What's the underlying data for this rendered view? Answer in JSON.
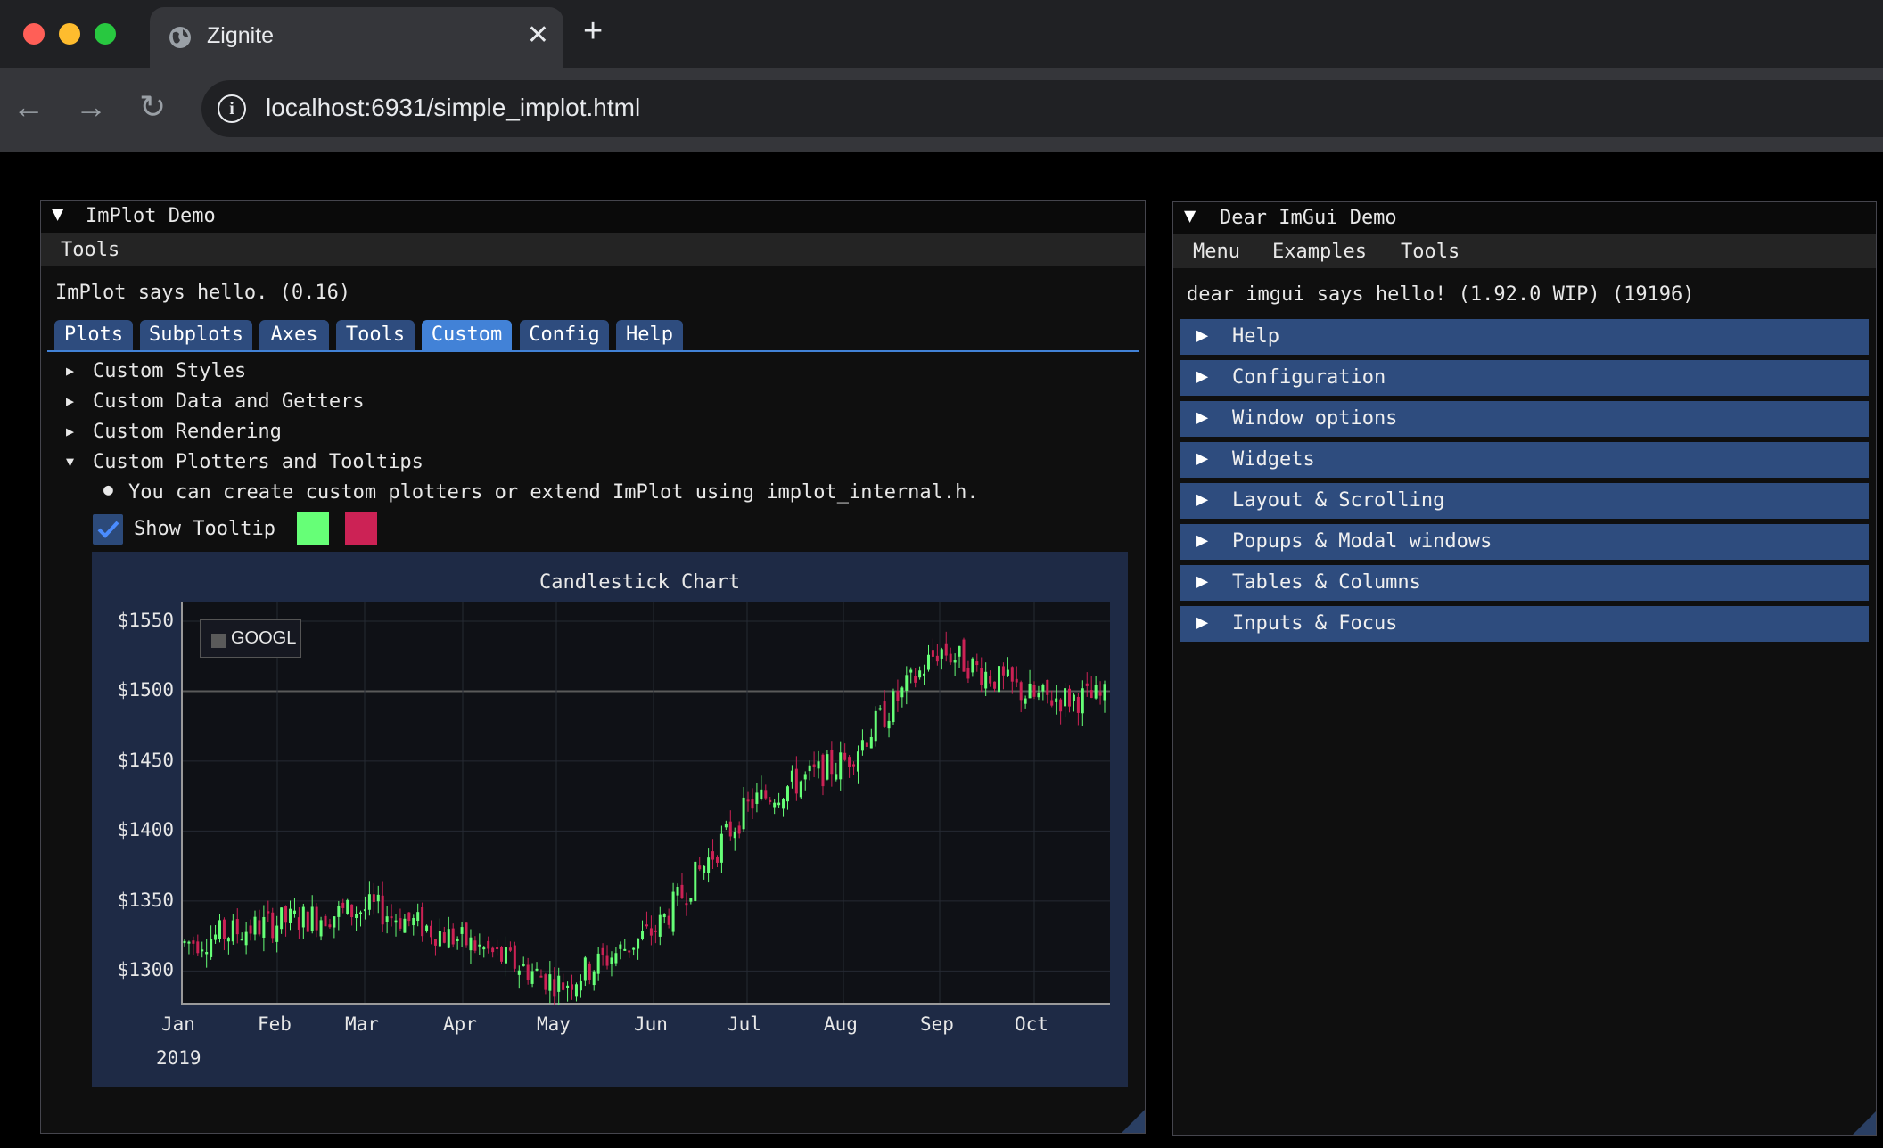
{
  "browser": {
    "tab_title": "Zignite",
    "tab_close": "✕",
    "new_tab": "+",
    "url": "localhost:6931/simple_implot.html",
    "back": "←",
    "forward": "→",
    "reload": "↻",
    "info": "i"
  },
  "implot_window": {
    "title": "ImPlot Demo",
    "collapse_arrow": "▼",
    "menu": [
      "Tools"
    ],
    "hello": "ImPlot says hello. (0.16)",
    "tabs": [
      "Plots",
      "Subplots",
      "Axes",
      "Tools",
      "Custom",
      "Config",
      "Help"
    ],
    "active_tab": "Custom",
    "tree": [
      {
        "label": "Custom Styles",
        "open": false
      },
      {
        "label": "Custom Data and Getters",
        "open": false
      },
      {
        "label": "Custom Rendering",
        "open": false
      },
      {
        "label": "Custom Plotters and Tooltips",
        "open": true
      }
    ],
    "bullet_text": "You can create custom plotters or extend ImPlot using implot_internal.h.",
    "show_tooltip_label": "Show Tooltip",
    "show_tooltip_checked": true,
    "bull_color": "#66ff77",
    "bear_color": "#cc2255"
  },
  "chart_data": {
    "type": "candlestick",
    "title": "Candlestick Chart",
    "series_name": "GOOGL",
    "x_tick_labels": [
      "Jan",
      "Feb",
      "Mar",
      "Apr",
      "May",
      "Jun",
      "Jul",
      "Aug",
      "Sep",
      "Oct"
    ],
    "x_year_label": "2019",
    "y_tick_labels": [
      "$1550",
      "$1500",
      "$1450",
      "$1400",
      "$1350",
      "$1300"
    ],
    "y_ticks": [
      1550,
      1500,
      1450,
      1400,
      1350,
      1300
    ],
    "ylim": [
      1276,
      1564
    ],
    "x_months": [
      "2019-01",
      "2019-02",
      "2019-03",
      "2019-04",
      "2019-05",
      "2019-06",
      "2019-07",
      "2019-08",
      "2019-09",
      "2019-10"
    ],
    "monthly_close": [
      1320,
      1335,
      1345,
      1320,
      1290,
      1330,
      1420,
      1450,
      1530,
      1495
    ],
    "grid": true,
    "legend_position": "top-left",
    "up_color": "#66ff77",
    "down_color": "#cc2255"
  },
  "imgui_window": {
    "title": "Dear ImGui Demo",
    "collapse_arrow": "▼",
    "menu": [
      "Menu",
      "Examples",
      "Tools"
    ],
    "hello": "dear imgui says hello! (1.92.0 WIP) (19196)",
    "headers": [
      "Help",
      "Configuration",
      "Window options",
      "Widgets",
      "Layout & Scrolling",
      "Popups & Modal windows",
      "Tables & Columns",
      "Inputs & Focus"
    ]
  }
}
